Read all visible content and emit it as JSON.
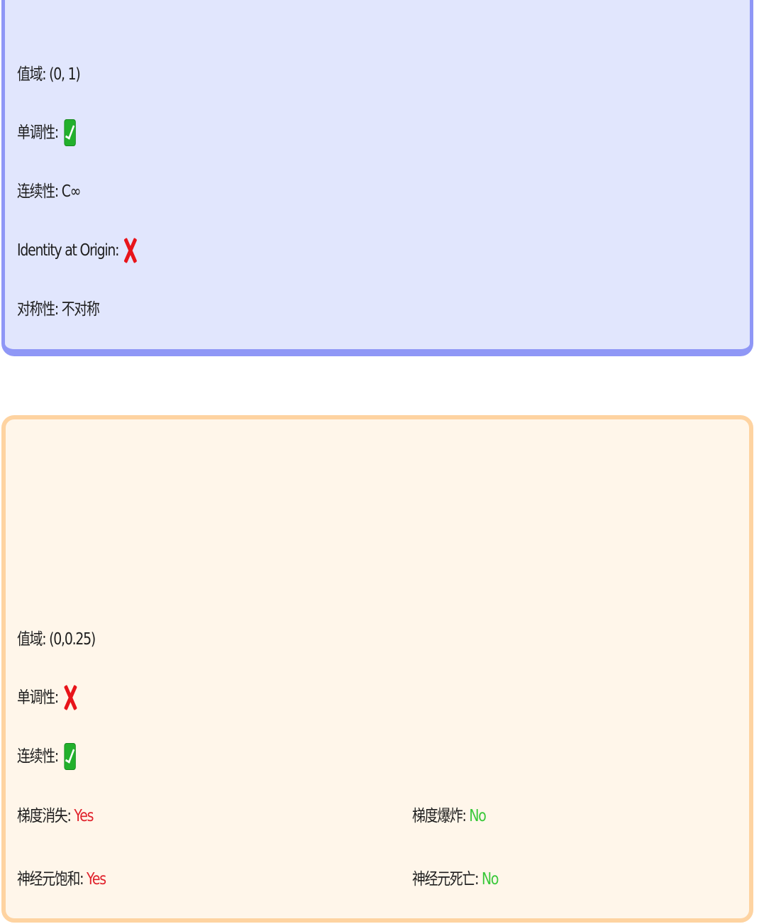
{
  "card1": {
    "rows": [
      {
        "label": "值域:",
        "value": "(0, 1)"
      },
      {
        "label": "单调性:",
        "icon": "check-icon"
      },
      {
        "label": "连续性:",
        "value": "C∞"
      },
      {
        "label": "Identity at Origin:",
        "icon": "cross-icon"
      },
      {
        "label": "对称性:",
        "value": "不对称"
      }
    ]
  },
  "card2": {
    "rows": [
      {
        "label": "值域:",
        "value": "(0,0.25)"
      },
      {
        "label": "单调性:",
        "icon": "cross-icon"
      },
      {
        "label": "连续性:",
        "icon": "check-icon"
      }
    ],
    "gradient_vanishing": {
      "label": "梯度消失:",
      "value": "Yes"
    },
    "gradient_exploding": {
      "label": "梯度爆炸:",
      "value": "No"
    },
    "neuron_saturation": {
      "label": "神经元饱和:",
      "value": "Yes"
    },
    "neuron_death": {
      "label": "神经元死亡:",
      "value": "No"
    }
  },
  "colors": {
    "card1_bg": "#e1e6fd",
    "card1_border": "#8f97f6",
    "card2_bg": "#fff6ea",
    "card2_border": "#fed3a1",
    "yes": "#e0202a",
    "no": "#38c838",
    "check": "#22b02c",
    "cross": "#e8141a"
  }
}
